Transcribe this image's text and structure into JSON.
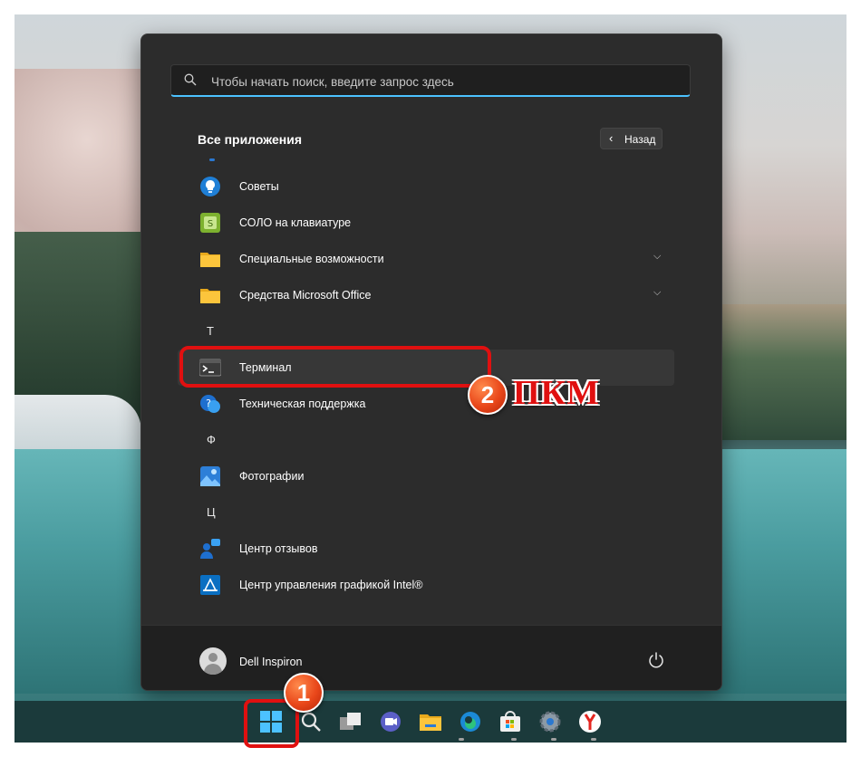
{
  "search": {
    "placeholder": "Чтобы начать поиск, введите запрос здесь"
  },
  "section": {
    "title": "Все приложения",
    "back_label": "Назад"
  },
  "apps": [
    {
      "name": "Советы",
      "icon": "tips-bulb-icon"
    },
    {
      "name": "СОЛО на клавиатуре",
      "icon": "solo-keyboard-icon"
    },
    {
      "name": "Специальные возможности",
      "icon": "folder-icon",
      "expandable": true
    },
    {
      "name": "Средства Microsoft Office",
      "icon": "folder-icon",
      "expandable": true
    },
    {
      "letter": "Т"
    },
    {
      "name": "Терминал",
      "icon": "terminal-icon",
      "highlighted": true
    },
    {
      "name": "Техническая поддержка",
      "icon": "support-icon"
    },
    {
      "letter": "Ф"
    },
    {
      "name": "Фотографии",
      "icon": "photos-icon"
    },
    {
      "letter": "Ц"
    },
    {
      "name": "Центр отзывов",
      "icon": "feedback-hub-icon"
    },
    {
      "name": "Центр управления графикой Intel®",
      "icon": "intel-graphics-icon"
    }
  ],
  "user": {
    "name": "Dell Inspiron"
  },
  "taskbar": [
    "start-icon",
    "search-icon",
    "task-view-icon",
    "chat-icon",
    "file-explorer-icon",
    "edge-icon",
    "store-icon",
    "settings-icon",
    "yandex-browser-icon"
  ],
  "annotations": {
    "step1": "1",
    "step2": "2",
    "step2_label": "ПКМ"
  },
  "colors": {
    "accent": "#4cc2ff",
    "annotation_red": "#e01010",
    "menu_bg": "#2c2c2c"
  }
}
